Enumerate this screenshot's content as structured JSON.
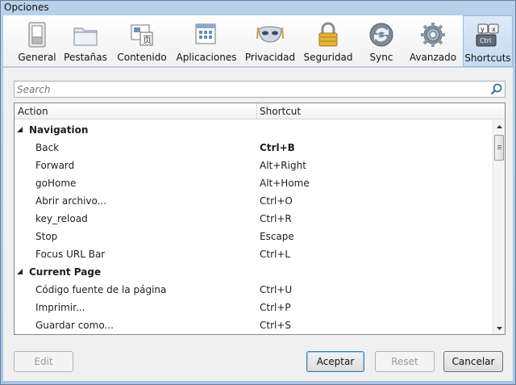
{
  "window": {
    "title": "Opciones"
  },
  "toolbar": {
    "items": [
      {
        "label": "General",
        "icon": "general-switch-icon"
      },
      {
        "label": "Pestañas",
        "icon": "tabs-folder-icon"
      },
      {
        "label": "Contenido",
        "icon": "content-page-icon"
      },
      {
        "label": "Aplicaciones",
        "icon": "applications-window-icon"
      },
      {
        "label": "Privacidad",
        "icon": "privacy-mask-icon"
      },
      {
        "label": "Seguridad",
        "icon": "security-padlock-icon"
      },
      {
        "label": "Sync",
        "icon": "sync-icon"
      },
      {
        "label": "Avanzado",
        "icon": "advanced-gear-icon"
      },
      {
        "label": "Shortcuts",
        "icon": "shortcuts-keys-icon",
        "active": true
      }
    ]
  },
  "search": {
    "placeholder": "Search"
  },
  "tree": {
    "columns": {
      "action": "Action",
      "shortcut": "Shortcut"
    },
    "groups": [
      {
        "name": "Navigation",
        "expanded": true,
        "items": [
          {
            "action": "Back",
            "shortcut": "Ctrl+B",
            "bold": true
          },
          {
            "action": "Forward",
            "shortcut": "Alt+Right"
          },
          {
            "action": "goHome",
            "shortcut": "Alt+Home"
          },
          {
            "action": "Abrir archivo...",
            "shortcut": "Ctrl+O"
          },
          {
            "action": "key_reload",
            "shortcut": "Ctrl+R"
          },
          {
            "action": "Stop",
            "shortcut": "Escape"
          },
          {
            "action": "Focus URL Bar",
            "shortcut": "Ctrl+L"
          }
        ]
      },
      {
        "name": "Current Page",
        "expanded": true,
        "items": [
          {
            "action": "Código fuente de la página",
            "shortcut": "Ctrl+U"
          },
          {
            "action": "Imprimir...",
            "shortcut": "Ctrl+P"
          },
          {
            "action": "Guardar como...",
            "shortcut": "Ctrl+S"
          }
        ]
      }
    ]
  },
  "buttons": {
    "edit": "Edit",
    "accept": "Aceptar",
    "reset": "Reset",
    "cancel": "Cancelar"
  }
}
